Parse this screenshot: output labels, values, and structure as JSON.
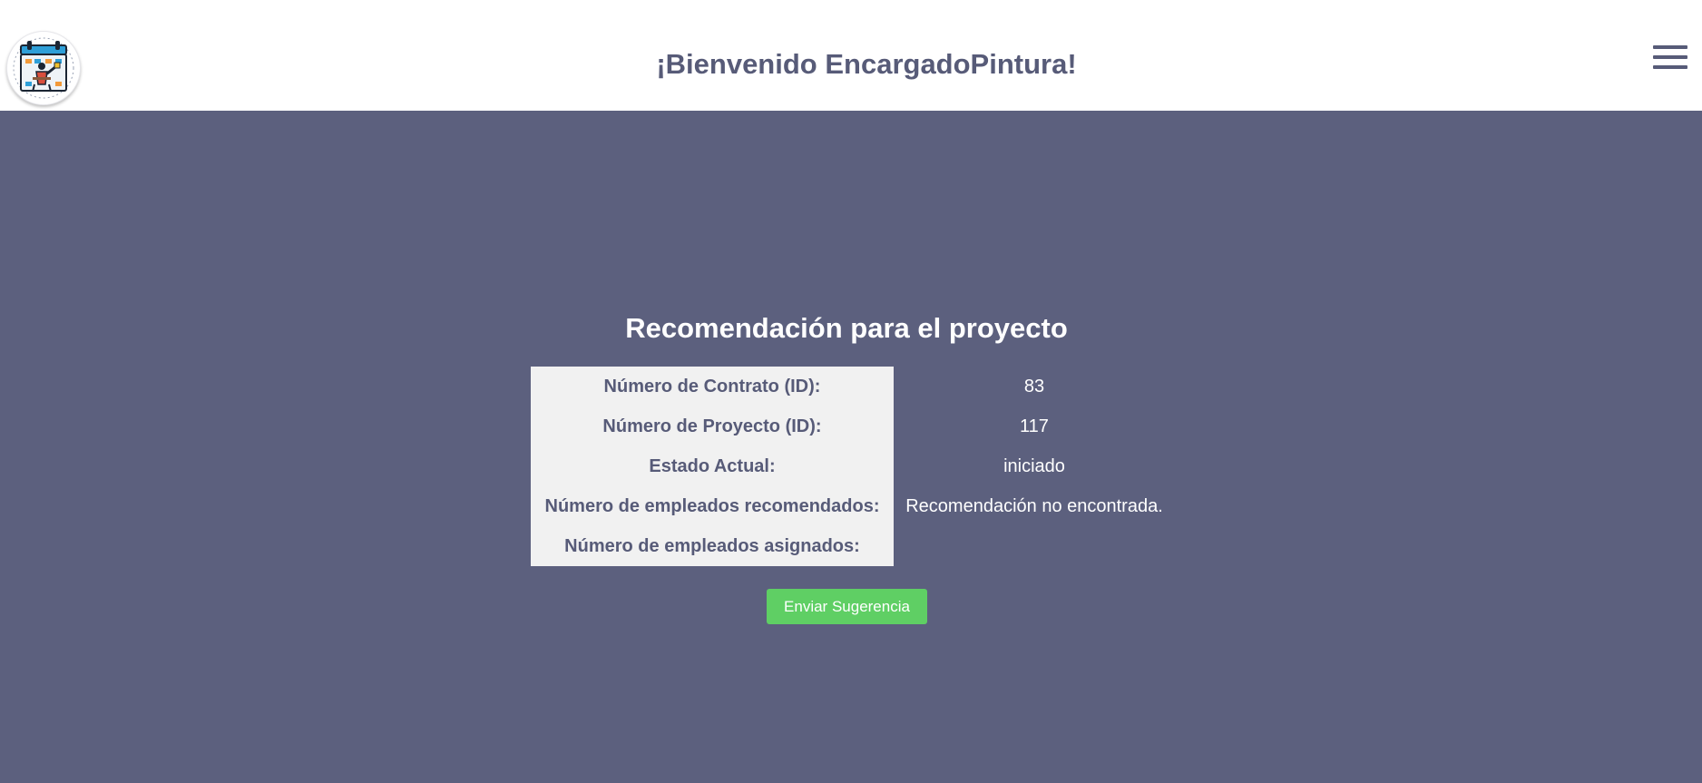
{
  "header": {
    "welcome": "¡Bienvenido EncargadoPintura!",
    "logo_icon": "painter-calendar-logo-icon",
    "menu_icon": "hamburger-menu-icon"
  },
  "main": {
    "title": "Recomendación para el proyecto",
    "rows": [
      {
        "label": "Número de Contrato (ID):",
        "value": "83"
      },
      {
        "label": "Número de Proyecto (ID):",
        "value": "117"
      },
      {
        "label": "Estado Actual:",
        "value": "iniciado"
      },
      {
        "label": "Número de empleados recomendados:",
        "value": "Recomendación no encontrada."
      },
      {
        "label": "Número de empleados asignados:",
        "value": ""
      }
    ],
    "submit_label": "Enviar Sugerencia"
  },
  "colors": {
    "background": "#5c607e",
    "header_background": "#ffffff",
    "text_accent": "#575b78",
    "label_cell_background": "#f1f1f1",
    "button_green": "#5fcf64"
  }
}
